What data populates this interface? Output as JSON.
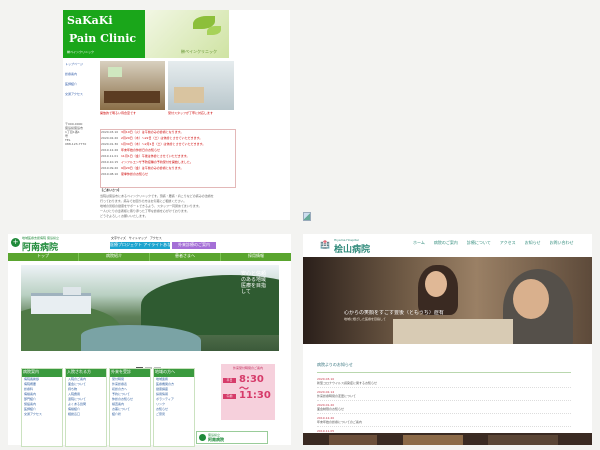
{
  "panel1": {
    "logo_line1": "SaKaKi",
    "logo_line2": "Pain Clinic",
    "logo_sub": "榊ペインクリニック",
    "header_jp": "榊ペインクリニック",
    "sidenav": [
      "トップページ",
      "診療案内",
      "医師紹介",
      "交通アクセス"
    ],
    "sideinfo": [
      "〒000-0000",
      "徳島県徳島市",
      "1丁目1番1",
      "号",
      "TEL",
      "088-123-7770"
    ],
    "photo_caption1": "開放的で明るい待合室です",
    "photo_caption2": "受付スタッフが丁寧に対応します",
    "news": [
      {
        "date": "2020.03.10",
        "text": "3月10日（火）は午前のみの診療となります。"
      },
      {
        "date": "2020.02.20",
        "text": "2月20日（木）～22日（土）は休診とさせていただきます。"
      },
      {
        "date": "2020.01.30",
        "text": "1月30日（木）～2月1日（土）は休診とさせていただきます。"
      },
      {
        "date": "2019.12.26",
        "text": "年末年始の休診日のお知らせ"
      },
      {
        "date": "2019.11.01",
        "text": "11月1日（金）午後は休診とさせていただきます。"
      },
      {
        "date": "2019.10.15",
        "text": "インフルエンザ予防接種の予約受付を開始しました。"
      },
      {
        "date": "2019.09.20",
        "text": "9月20日（金）は午前のみの診療となります。"
      },
      {
        "date": "2019.08.10",
        "text": "夏季休診のお知らせ"
      }
    ],
    "about_heading": "【ごあいさつ】",
    "about_lines": [
      "当院は徳島市にあるペインクリニックです。頭痛・腰痛・肩こりなどの痛みの治療を",
      "行っております。痛みでお困りの方はお気軽にご相談ください。",
      "地域の皆様の健康をサポートできるよう、スタッフ一同努めてまいります。",
      "一人ひとりの患者様に寄り添った丁寧な診療を心がけております。",
      "どうぞよろしくお願いいたします。"
    ]
  },
  "panel2": {
    "logo_sub": "地域医療支援病院 徳島県立",
    "logo_main": "阿南病院",
    "header_links": "文字サイズ　サイトマップ　アクセス",
    "badge1": "医療プロジェクト アイライトあなん",
    "badge2": "外来診療のご案内",
    "nav": [
      "トップ",
      "病院紹介",
      "患者さまへ",
      "採用情報"
    ],
    "hero_vertical": "安心と信頼のある地域医療を目指して",
    "columns": [
      {
        "title": "病院案内",
        "items": [
          "病院長挨拶",
          "病院概要",
          "診療科",
          "病棟案内",
          "部門紹介",
          "施設案内",
          "医師紹介",
          "交通アクセス"
        ]
      },
      {
        "title": "入院される方",
        "items": [
          "入院のご案内",
          "面会について",
          "持ち物",
          "入院費用",
          "退院について",
          "よくある質問",
          "病棟紹介",
          "相談窓口"
        ]
      },
      {
        "title": "外来を受診",
        "items": [
          "受付時間",
          "外来診療表",
          "初診の方へ",
          "予約について",
          "休診のお知らせ",
          "検査案内",
          "お薬について",
          "紹介状"
        ]
      },
      {
        "title": "地域の方へ",
        "items": [
          "地域連携",
          "医療機関の方",
          "健康講座",
          "採用情報",
          "ボランティア",
          "リンク",
          "お知らせ",
          "ご意見"
        ]
      }
    ],
    "hours_title": "外来受付時間のご案内",
    "hours": [
      {
        "label": "平日",
        "value": "8:30 〜"
      },
      {
        "label": "午前",
        "value": "11:30"
      }
    ],
    "foot_sub": "徳島県立",
    "foot_main": "阿南病院"
  },
  "panel3": {
    "logo_icon": "🏥",
    "logo_sub": "Hiyama Hospital",
    "logo_main": "桧山病院",
    "nav": [
      "ホーム",
      "病院のご案内",
      "診療について",
      "アクセス",
      "お知らせ",
      "お問い合わせ"
    ],
    "hero_title": "心からの笑顔をすごす豊後（ともうち）症有",
    "hero_sub": "地域に根ざした医療を目指して",
    "news_heading": "病院よりのお知らせ",
    "news": [
      {
        "date": "2020.03.10",
        "text": "新型コロナウイルス感染症に関するお知らせ"
      },
      {
        "date": "2020.02.14",
        "text": "外来診療時間の変更について"
      },
      {
        "date": "2020.01.20",
        "text": "面会制限のお知らせ"
      },
      {
        "date": "2019.12.20",
        "text": "年末年始の診療についてのご案内"
      },
      {
        "date": "2019.11.05",
        "text": "インフルエンザ予防接種について"
      }
    ]
  },
  "colors": {
    "sakaki_green": "#1aa61a",
    "anan_green": "#5aa52f",
    "anan_pink": "#f6d0dc",
    "hiyama_teal": "#2f8a7a"
  }
}
